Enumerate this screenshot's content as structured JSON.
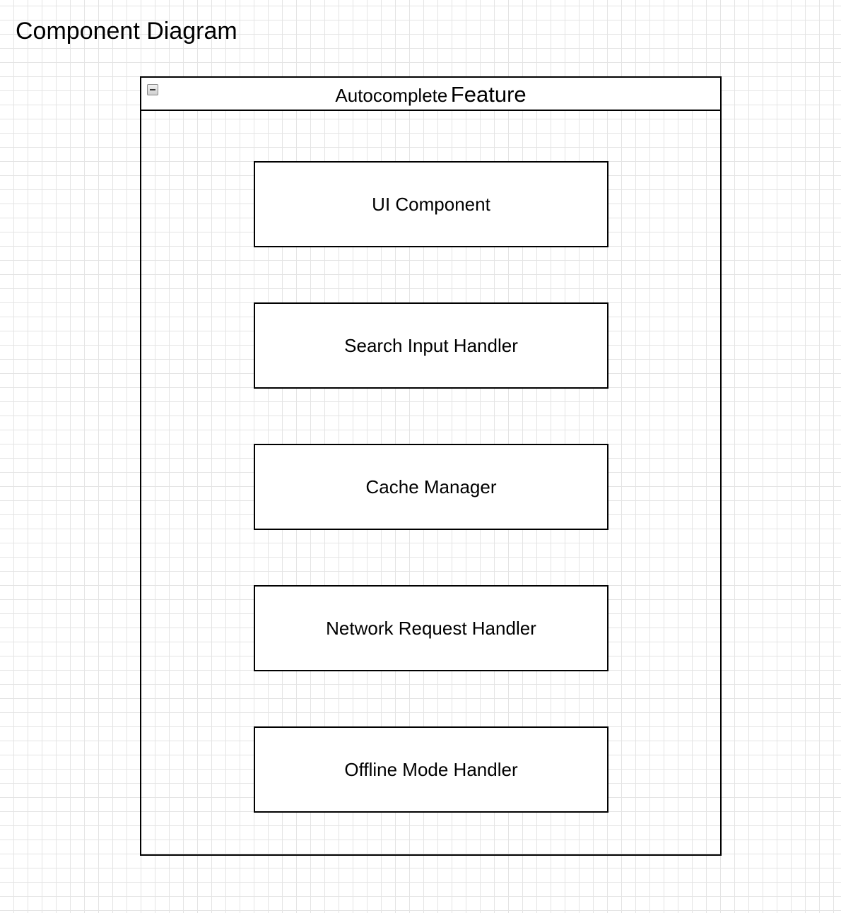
{
  "diagram": {
    "title": "Component Diagram"
  },
  "container": {
    "title_part_a": "Autocomplete",
    "title_part_b": "Feature",
    "collapse_icon": "minus-icon"
  },
  "components": [
    {
      "label": "UI Component"
    },
    {
      "label": "Search Input Handler"
    },
    {
      "label": "Cache Manager"
    },
    {
      "label": "Network Request Handler"
    },
    {
      "label": "Offline Mode Handler"
    }
  ]
}
